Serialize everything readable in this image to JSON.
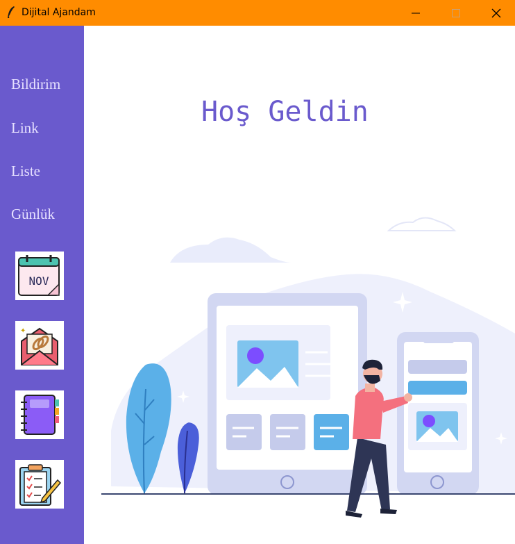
{
  "window": {
    "title": "Dijital Ajandam"
  },
  "sidebar": {
    "nav_items": [
      {
        "label": "Bildirim"
      },
      {
        "label": "Link"
      },
      {
        "label": "Liste"
      },
      {
        "label": "Günlük"
      }
    ],
    "tiles": [
      {
        "icon": "calendar-icon",
        "text": "NOV"
      },
      {
        "icon": "envelope-link-icon"
      },
      {
        "icon": "notebook-icon"
      },
      {
        "icon": "checklist-icon"
      }
    ]
  },
  "main": {
    "welcome_text": "Hoş Geldin"
  },
  "colors": {
    "titlebar": "#ff8c00",
    "sidebar": "#6a5acd",
    "accent": "#6a5acd"
  }
}
